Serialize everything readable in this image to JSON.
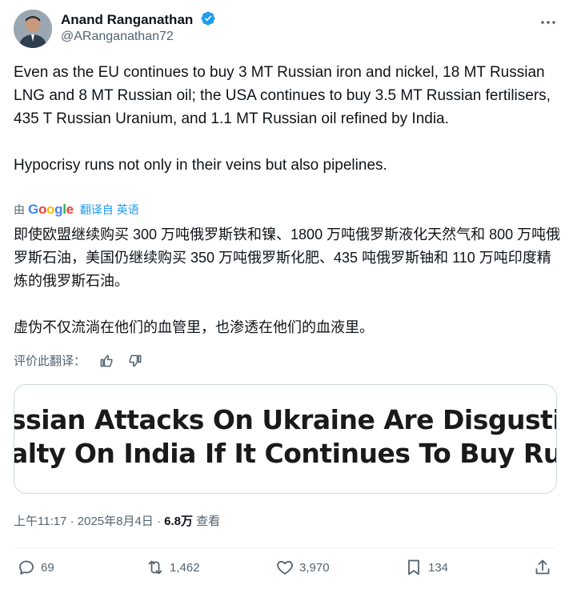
{
  "author": {
    "name": "Anand Ranganathan",
    "handle": "@ARanganathan72"
  },
  "tweet": {
    "paragraph1": "Even as the EU continues to buy 3 MT Russian iron and nickel, 18 MT Russian LNG and 8 MT Russian oil; the USA continues to buy 3.5 MT Russian fertilisers, 435 T Russian Uranium, and 1.1 MT Russian oil refined by India.",
    "paragraph2": "Hypocrisy runs not only in their veins but also pipelines."
  },
  "translation": {
    "by_label": "由",
    "provider": "Google",
    "source_label": "翻译自 英语",
    "paragraph1": "即使欧盟继续购买 300 万吨俄罗斯铁和镍、1800 万吨俄罗斯液化天然气和 800 万吨俄罗斯石油，美国仍继续购买 350 万吨俄罗斯化肥、435 吨俄罗斯铀和 110 万吨印度精炼的俄罗斯石油。",
    "paragraph2": "虚伪不仅流淌在他们的血管里，也渗透在他们的血液里。",
    "rate_label": "评价此翻译："
  },
  "card": {
    "line1": "ssian Attacks On Ukraine Are Disgusting, W",
    "line2": "alty On India If It Continues To Buy Russian"
  },
  "meta": {
    "time_date": "上午11:17 · 2025年8月4日 · ",
    "views_count": "6.8万",
    "views_label": " 查看"
  },
  "actions": {
    "replies": "69",
    "retweets": "1,462",
    "likes": "3,970",
    "bookmarks": "134"
  },
  "colors": {
    "accent": "#1d9bf0",
    "muted": "#536471",
    "text": "#0f1419"
  }
}
